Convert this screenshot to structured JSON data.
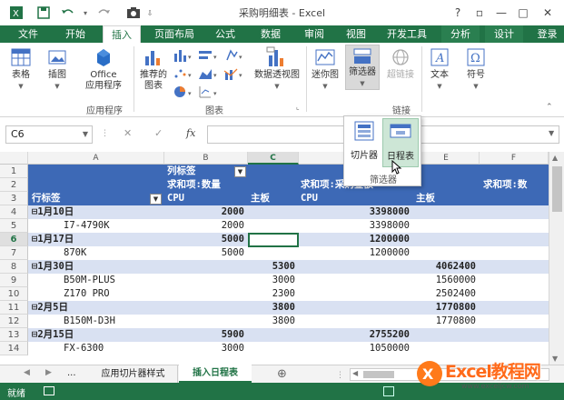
{
  "title_bar": {
    "document_title": "采购明细表 - Excel",
    "help": "?",
    "restore": "▫",
    "minimize": "—",
    "maximize": "□",
    "close": "✕",
    "save_icon": "save-icon",
    "undo_icon": "undo-icon",
    "redo_icon": "redo-icon",
    "screenshot_icon": "camera-icon"
  },
  "tabs": [
    "文件",
    "开始",
    "插入",
    "页面布局",
    "公式",
    "数据",
    "审阅",
    "视图",
    "开发工具",
    "分析",
    "设计",
    "登录"
  ],
  "active_tab": "插入",
  "ribbon": {
    "table": "表格",
    "illustration": "插图",
    "office_apps_line1": "Office",
    "office_apps_line2": "应用程序",
    "apps_group": "应用程序",
    "recommended_line1": "推荐的",
    "recommended_line2": "图表",
    "charts_group": "图表",
    "pivot_chart": "数据透视图",
    "sparklines": "迷你图",
    "filter": "筛选器",
    "hyperlink": "超链接",
    "links_group": "链接",
    "text": "文本",
    "symbol": "符号",
    "dropdown": {
      "slicer": "切片器",
      "timeline": "日程表",
      "group_label": "筛选器"
    }
  },
  "formula_bar": {
    "name_box": "C6",
    "cancel": "✕",
    "enter": "✓",
    "fx": "fx"
  },
  "columns": [
    "A",
    "B",
    "C",
    "D",
    "E",
    "F"
  ],
  "rows": [
    "1",
    "2",
    "3",
    "4",
    "5",
    "6",
    "7",
    "8",
    "9",
    "10",
    "11",
    "12",
    "13",
    "14"
  ],
  "pivot": {
    "col_label": "列标签",
    "row_label": "行标签",
    "sum_qty": "求和项:数量",
    "sum_amount": "求和项:采购金额",
    "sum_amount_short": "求和项:数",
    "cpu": "CPU",
    "board": "主板",
    "items": [
      {
        "row": "4",
        "label": "⊟1月10日",
        "b": "2000",
        "c": "",
        "d": "3398000",
        "e": ""
      },
      {
        "row": "5",
        "label": "I7-4790K",
        "b": "2000",
        "c": "",
        "d": "3398000",
        "e": ""
      },
      {
        "row": "6",
        "label": "⊟1月17日",
        "b": "5000",
        "c": "",
        "d": "1200000",
        "e": ""
      },
      {
        "row": "7",
        "label": "870K",
        "b": "5000",
        "c": "",
        "d": "1200000",
        "e": ""
      },
      {
        "row": "8",
        "label": "⊟1月30日",
        "b": "",
        "c": "5300",
        "d": "",
        "e": "4062400"
      },
      {
        "row": "9",
        "label": "B50M-PLUS",
        "b": "",
        "c": "3000",
        "d": "",
        "e": "1560000"
      },
      {
        "row": "10",
        "label": "Z170 PRO",
        "b": "",
        "c": "2300",
        "d": "",
        "e": "2502400"
      },
      {
        "row": "11",
        "label": "⊟2月5日",
        "b": "",
        "c": "3800",
        "d": "",
        "e": "1770800"
      },
      {
        "row": "12",
        "label": "B150M-D3H",
        "b": "",
        "c": "3800",
        "d": "",
        "e": "1770800"
      },
      {
        "row": "13",
        "label": "⊟2月15日",
        "b": "5900",
        "c": "",
        "d": "2755200",
        "e": ""
      },
      {
        "row": "14",
        "label": "FX-6300",
        "b": "3000",
        "c": "",
        "d": "1050000",
        "e": ""
      }
    ]
  },
  "sheet_tabs": {
    "more": "...",
    "tab1": "应用切片器样式",
    "tab2": "插入日程表",
    "add": "⊕"
  },
  "status": {
    "ready": "就绪"
  },
  "watermark": {
    "logo": "Excel教程网",
    "url": "www.exceljcw.com"
  },
  "colors": {
    "excel_green": "#217346",
    "pivot_header": "#3d69b6",
    "group_row": "#d9e1f2"
  }
}
